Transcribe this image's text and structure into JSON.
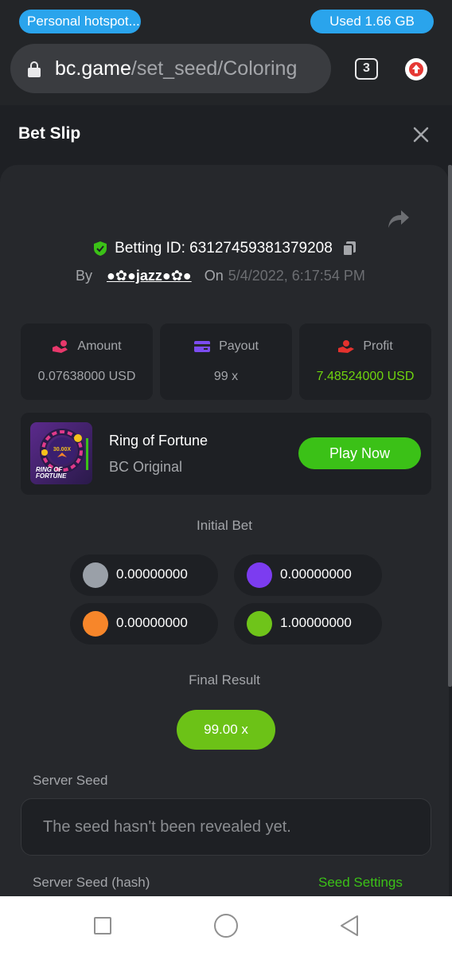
{
  "status_bar": {
    "hotspot_label": "Personal hotspot...",
    "data_used": "Used  1.66 GB"
  },
  "browser": {
    "url_host": "bc.game",
    "url_path": "/set_seed/Coloring",
    "tab_count": "3"
  },
  "slip": {
    "title": "Bet Slip"
  },
  "bet": {
    "betting_id": "Betting ID: 63127459381379208",
    "by_label": "By",
    "user": "●✿●jazz●✿●",
    "on_label": "On",
    "date": "5/4/2022, 6:17:54 PM"
  },
  "stats": {
    "amount_label": "Amount",
    "amount_value": "0.07638000 USD",
    "payout_label": "Payout",
    "payout_value": "99 x",
    "profit_label": "Profit",
    "profit_value": "7.48524000 USD"
  },
  "game": {
    "name": "Ring of Fortune",
    "provider": "BC Original",
    "play_label": "Play Now",
    "thumb_multiplier": "30.00X",
    "thumb_title_1": "RING OF",
    "thumb_title_2": "FORTUNE"
  },
  "initial_bet": {
    "title": "Initial Bet",
    "bets": [
      {
        "color": "#9aa0a8",
        "value": "0.00000000"
      },
      {
        "color": "#7c3cf0",
        "value": "0.00000000"
      },
      {
        "color": "#f7862a",
        "value": "0.00000000"
      },
      {
        "color": "#6fc41a",
        "value": "1.00000000"
      }
    ]
  },
  "final_result": {
    "title": "Final Result",
    "value": "99.00 x"
  },
  "server_seed": {
    "label": "Server Seed",
    "value": "The seed hasn't been revealed yet.",
    "hash_label": "Server Seed (hash)",
    "settings_link": "Seed Settings"
  },
  "colors": {
    "accent_green": "#3bc117",
    "profit_green": "#6fd40e",
    "hotspot_blue": "#2aa4ec"
  }
}
